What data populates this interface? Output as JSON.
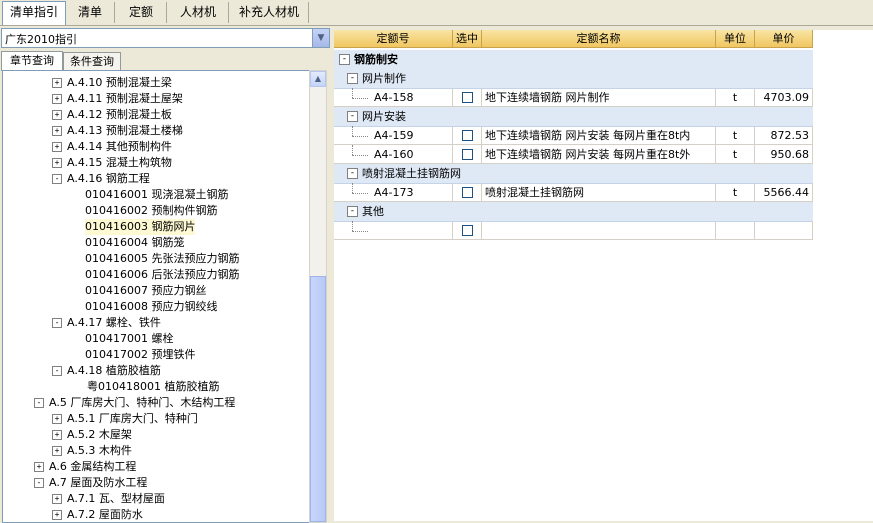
{
  "top_tabs": [
    "清单指引",
    "清单",
    "定额",
    "人材机",
    "补充人材机"
  ],
  "selector": {
    "value": "广东2010指引"
  },
  "sub_tabs": [
    "章节查询",
    "条件查询"
  ],
  "tree": [
    {
      "label": "A.4.10 预制混凝土梁",
      "level": 2,
      "exp": "+"
    },
    {
      "label": "A.4.11 预制混凝土屋架",
      "level": 2,
      "exp": "+"
    },
    {
      "label": "A.4.12 预制混凝土板",
      "level": 2,
      "exp": "+"
    },
    {
      "label": "A.4.13 预制混凝土楼梯",
      "level": 2,
      "exp": "+"
    },
    {
      "label": "A.4.14 其他预制构件",
      "level": 2,
      "exp": "+"
    },
    {
      "label": "A.4.15 混凝土构筑物",
      "level": 2,
      "exp": "+"
    },
    {
      "label": "A.4.16 钢筋工程",
      "level": 2,
      "exp": "-"
    },
    {
      "label": "010416001  现浇混凝土钢筋",
      "level": 3,
      "exp": ""
    },
    {
      "label": "010416002  预制构件钢筋",
      "level": 3,
      "exp": ""
    },
    {
      "label": "010416003  钢筋网片",
      "level": 3,
      "exp": "",
      "selected": true
    },
    {
      "label": "010416004  钢筋笼",
      "level": 3,
      "exp": ""
    },
    {
      "label": "010416005  先张法预应力钢筋",
      "level": 3,
      "exp": ""
    },
    {
      "label": "010416006  后张法预应力钢筋",
      "level": 3,
      "exp": ""
    },
    {
      "label": "010416007  预应力钢丝",
      "level": 3,
      "exp": ""
    },
    {
      "label": "010416008  预应力钢绞线",
      "level": 3,
      "exp": ""
    },
    {
      "label": "A.4.17 螺栓、铁件",
      "level": 2,
      "exp": "-"
    },
    {
      "label": "010417001  螺栓",
      "level": 3,
      "exp": ""
    },
    {
      "label": "010417002  预埋铁件",
      "level": 3,
      "exp": ""
    },
    {
      "label": "A.4.18 植筋胶植筋",
      "level": 2,
      "exp": "-"
    },
    {
      "label": "粤010418001  植筋胶植筋",
      "level": 3,
      "exp": ""
    },
    {
      "label": "A.5 厂库房大门、特种门、木结构工程",
      "level": 1,
      "exp": "-"
    },
    {
      "label": "A.5.1 厂库房大门、特种门",
      "level": 2,
      "exp": "+"
    },
    {
      "label": "A.5.2 木屋架",
      "level": 2,
      "exp": "+"
    },
    {
      "label": "A.5.3 木构件",
      "level": 2,
      "exp": "+"
    },
    {
      "label": "A.6 金属结构工程",
      "level": 1,
      "exp": "+"
    },
    {
      "label": "A.7 屋面及防水工程",
      "level": 1,
      "exp": "-"
    },
    {
      "label": "A.7.1 瓦、型材屋面",
      "level": 2,
      "exp": "+"
    },
    {
      "label": "A.7.2 屋面防水",
      "level": 2,
      "exp": "+"
    }
  ],
  "grid": {
    "columns": [
      "定额号",
      "选中",
      "定额名称",
      "单位",
      "单价"
    ],
    "rows": [
      {
        "type": "group0",
        "text": "钢筋制安"
      },
      {
        "type": "group1",
        "text": "网片制作"
      },
      {
        "type": "item",
        "code": "A4-158",
        "name": "地下连续墙钢筋 网片制作",
        "unit": "t",
        "price": "4703.09"
      },
      {
        "type": "group1",
        "text": "网片安装"
      },
      {
        "type": "item",
        "code": "A4-159",
        "name": "地下连续墙钢筋 网片安装 每网片重在8t内",
        "unit": "t",
        "price": "872.53"
      },
      {
        "type": "item",
        "code": "A4-160",
        "name": "地下连续墙钢筋 网片安装 每网片重在8t外",
        "unit": "t",
        "price": "950.68"
      },
      {
        "type": "group1",
        "text": "喷射混凝土挂钢筋网"
      },
      {
        "type": "item",
        "code": "A4-173",
        "name": "喷射混凝土挂钢筋网",
        "unit": "t",
        "price": "5566.44"
      },
      {
        "type": "group1",
        "text": "其他"
      },
      {
        "type": "item",
        "code": "",
        "name": "",
        "unit": "",
        "price": ""
      }
    ]
  }
}
